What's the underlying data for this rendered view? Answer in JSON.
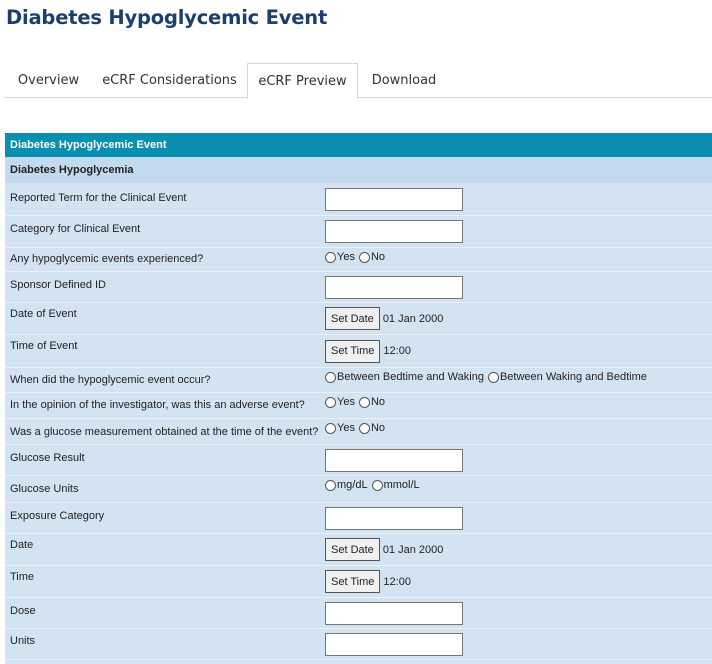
{
  "page": {
    "title": "Diabetes Hypoglycemic Event"
  },
  "tabs": [
    {
      "label": "Overview"
    },
    {
      "label": "eCRF Considerations"
    },
    {
      "label": "eCRF Preview",
      "active": true
    },
    {
      "label": "Download"
    }
  ],
  "form": {
    "header": "Diabetes Hypoglycemic Event",
    "section": "Diabetes Hypoglycemia",
    "colors": {
      "header_bg": "#0a8fb0",
      "section_bg": "#c3d9ee",
      "row_bg": "#d3e3f1"
    },
    "fields": [
      {
        "label": "Reported Term for the Clinical Event",
        "type": "text",
        "value": ""
      },
      {
        "label": "Category for Clinical Event",
        "type": "text",
        "value": ""
      },
      {
        "label": "Any hypoglycemic events experienced?",
        "type": "radio",
        "options": [
          "Yes",
          "No"
        ]
      },
      {
        "label": "Sponsor Defined ID",
        "type": "text",
        "value": ""
      },
      {
        "label": "Date of Event",
        "type": "button",
        "button": "Set Date",
        "value": "01 Jan 2000"
      },
      {
        "label": "Time of Event",
        "type": "button",
        "button": "Set Time",
        "value": "12:00"
      },
      {
        "label": "When did the hypoglycemic event occur?",
        "type": "radio",
        "options": [
          "Between Bedtime and Waking",
          "Between Waking and Bedtime"
        ]
      },
      {
        "label": "In the opinion of the investigator, was this an adverse event?",
        "type": "radio",
        "options": [
          "Yes",
          "No"
        ]
      },
      {
        "label": "Was a glucose measurement obtained at the time of the event?",
        "type": "radio",
        "options": [
          "Yes",
          "No"
        ]
      },
      {
        "label": "Glucose Result",
        "type": "text",
        "value": ""
      },
      {
        "label": "Glucose Units",
        "type": "radio",
        "options": [
          "mg/dL",
          "mmol/L"
        ]
      },
      {
        "label": "Exposure Category",
        "type": "text",
        "value": ""
      },
      {
        "label": "Date",
        "type": "button",
        "button": "Set Date",
        "value": "01 Jan 2000"
      },
      {
        "label": "Time",
        "type": "button",
        "button": "Set Time",
        "value": "12:00"
      },
      {
        "label": "Dose",
        "type": "text",
        "value": ""
      },
      {
        "label": "Units",
        "type": "text",
        "value": ""
      }
    ]
  }
}
